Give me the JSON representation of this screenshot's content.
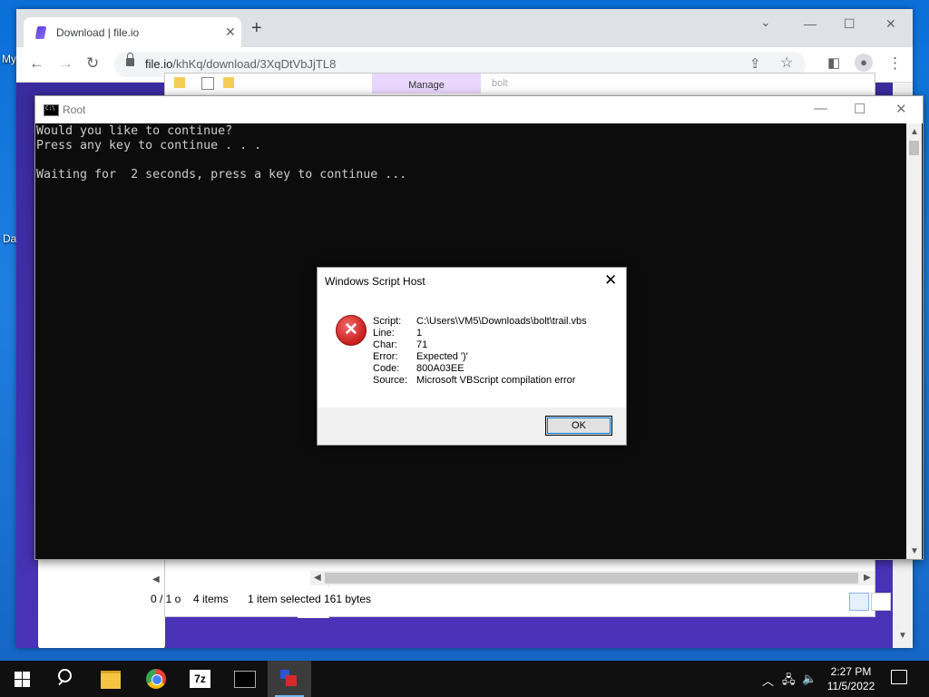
{
  "desktop": {
    "icon_label_1": "My",
    "icon_label_2": "Da"
  },
  "chrome": {
    "tab_title": "Download | file.io",
    "url_host": "file.io",
    "url_path": "/khKq/download/3XqDtVbJjTL8"
  },
  "explorer": {
    "manage_label": "Manage",
    "folder_name": "bolt",
    "items_count": "4 items",
    "selection": "1 item selected",
    "size": "161 bytes",
    "left_status": "0 / 1 o"
  },
  "console": {
    "title": "Root",
    "lines": [
      "Would you like to continue?",
      "Press any key to continue . . .",
      "",
      "Waiting for  2 seconds, press a key to continue ..."
    ]
  },
  "dialog": {
    "title": "Windows Script Host",
    "fields": [
      {
        "label": "Script:",
        "value": "C:\\Users\\VM5\\Downloads\\bolt\\trail.vbs"
      },
      {
        "label": "Line:",
        "value": "1"
      },
      {
        "label": "Char:",
        "value": "71"
      },
      {
        "label": "Error:",
        "value": "Expected ')'"
      },
      {
        "label": "Code:",
        "value": "800A03EE"
      },
      {
        "label": "Source:",
        "value": "Microsoft VBScript compilation error"
      }
    ],
    "ok_label": "OK"
  },
  "taskbar": {
    "time": "2:27 PM",
    "date": "11/5/2022",
    "seven_zip_label": "7z"
  }
}
